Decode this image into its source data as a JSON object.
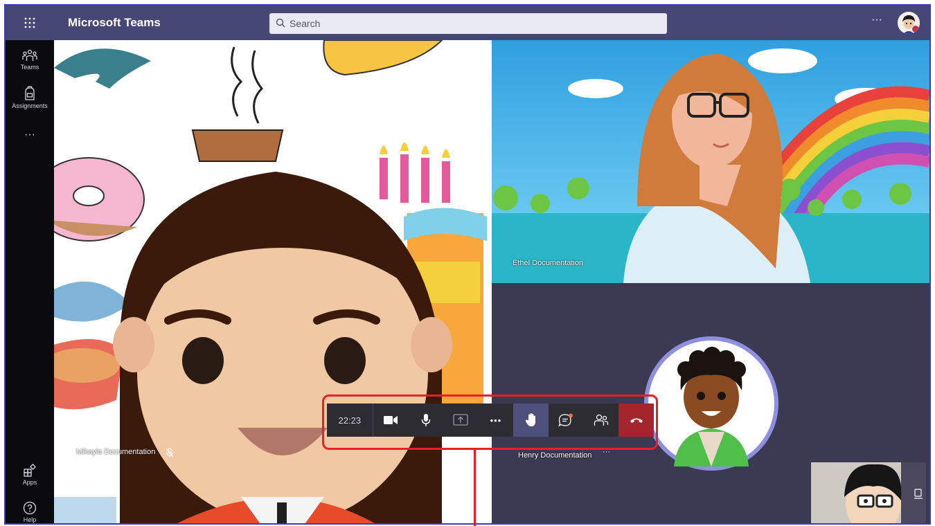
{
  "app": {
    "title": "Microsoft Teams",
    "search_placeholder": "Search",
    "more_label": "···"
  },
  "rail": {
    "items": [
      {
        "label": "Teams",
        "icon": "teams-icon"
      },
      {
        "label": "Assignments",
        "icon": "assignments-icon"
      },
      {
        "label": "···",
        "icon": "more-icon"
      },
      {
        "label": "Apps",
        "icon": "apps-icon"
      },
      {
        "label": "Help",
        "icon": "help-icon"
      }
    ]
  },
  "participants": [
    {
      "name": "Mikayla Documentation",
      "muted": true
    },
    {
      "name": "Ethel Documentation",
      "muted": false
    },
    {
      "name": "Henry Documentation",
      "more": "···"
    }
  ],
  "toolbar": {
    "time": "22:23",
    "buttons": [
      "camera",
      "microphone",
      "share-screen",
      "more-actions",
      "raise-hand",
      "chat",
      "participants",
      "hang-up"
    ],
    "more_label": "•••"
  },
  "colors": {
    "topbar": "#464775",
    "rail": "#0b0b0f",
    "hangup": "#a4262c",
    "raise_hand_active": "#4f4f7c",
    "highlight": "#ee1c24"
  }
}
